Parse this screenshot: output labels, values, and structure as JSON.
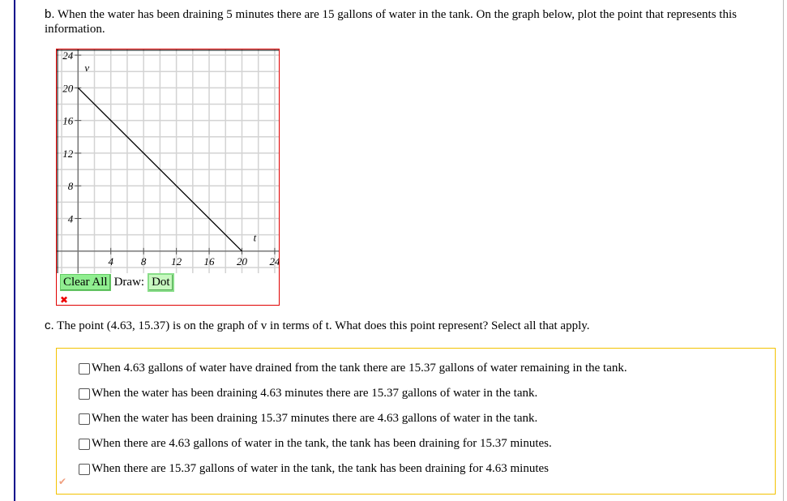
{
  "part_b": {
    "label": "b.",
    "text": "When the water has been draining 5 minutes there are 15 gallons of water in the tank. On the graph below, plot the point that represents this information."
  },
  "graph": {
    "x_axis_label": "t",
    "y_axis_label": "v",
    "x_ticks": [
      "4",
      "8",
      "12",
      "16",
      "20",
      "24"
    ],
    "y_ticks": [
      "24",
      "20",
      "16",
      "12",
      "8",
      "4"
    ],
    "line": {
      "from": [
        0,
        20
      ],
      "to": [
        20,
        0
      ]
    },
    "grid_step": 2,
    "xlim": [
      -2.6,
      24.5
    ],
    "ylim": [
      -2.7,
      24.7
    ]
  },
  "controls": {
    "clear_all": "Clear All",
    "draw_label": "Draw:",
    "dot": "Dot",
    "error_icon": "x-mark-icon",
    "error_color": "#e00000"
  },
  "part_c": {
    "label": "c.",
    "text": "The point (4.63, 15.37) is on the graph of v in terms of t. What does this point represent? Select all that apply."
  },
  "options": [
    "When 4.63 gallons of water have drained from the tank there are 15.37 gallons of water remaining in the tank.",
    "When the water has been draining 4.63 minutes there are 15.37 gallons of water in the tank.",
    "When the water has been draining 15.37 minutes there are 4.63 gallons of water in the tank.",
    "When there are 4.63 gallons of water in the tank, the tank has been draining for 15.37 minutes.",
    "When there are 15.37 gallons of water in the tank, the tank has been draining for 4.63 minutes"
  ],
  "colors": {
    "graph_border": "#e00000",
    "options_border": "#f3c200",
    "button": "#90ee90"
  }
}
